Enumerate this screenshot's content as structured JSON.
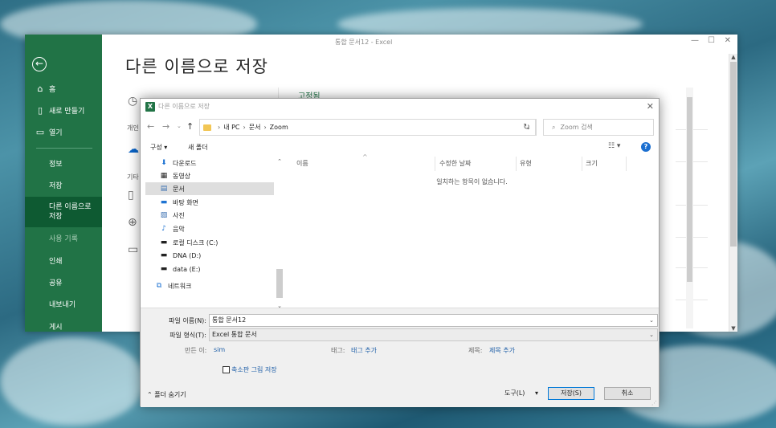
{
  "excel": {
    "window_title": "통합 문서12  -  Excel",
    "page_title": "다른 이름으로 저장",
    "recent_heading": "고정됨",
    "ghost_labels": {
      "personal": "개인",
      "other": "기타"
    },
    "sidebar": {
      "home": "홈",
      "new": "새로 만들기",
      "open": "열기",
      "info": "정보",
      "save": "저장",
      "save_as": "다른 이름으로\n저장",
      "history": "사용 기록",
      "print": "인쇄",
      "share": "공유",
      "export": "내보내기",
      "publish": "게시"
    }
  },
  "dialog": {
    "title": "다른 이름으로 저장",
    "address": {
      "items": [
        "내 PC",
        "문서",
        "Zoom"
      ]
    },
    "search_placeholder": "Zoom 검색",
    "toolbar": {
      "organize": "구성 ▾",
      "new_folder": "새 폴더"
    },
    "tree": [
      {
        "label": "다운로드",
        "icon": "download-icon"
      },
      {
        "label": "동영상",
        "icon": "video-icon"
      },
      {
        "label": "문서",
        "icon": "document-icon",
        "selected": true
      },
      {
        "label": "바탕 화면",
        "icon": "desktop-icon"
      },
      {
        "label": "사진",
        "icon": "picture-icon"
      },
      {
        "label": "음악",
        "icon": "music-icon"
      },
      {
        "label": "로컬 디스크 (C:)",
        "icon": "drive-icon"
      },
      {
        "label": "DNA (D:)",
        "icon": "drive-icon"
      },
      {
        "label": "data (E:)",
        "icon": "drive-icon"
      },
      {
        "label": "네트워크",
        "icon": "network-icon"
      }
    ],
    "columns": [
      "이름",
      "수정한 날짜",
      "유형",
      "크기"
    ],
    "empty_message": "일치하는 항목이 없습니다.",
    "file_name_label": "파일 이름(N):",
    "file_name_value": "통합 문서12",
    "file_type_label": "파일 형식(T):",
    "file_type_value": "Excel 통합 문서",
    "authors_label": "만든 이:",
    "authors_value": "sim",
    "tags_label": "태그:",
    "tags_value": "태그 추가",
    "title_label": "제목:",
    "title_value": "제목 추가",
    "thumbnail_label": "축소판 그림 저장",
    "hide_folders": "폴더 숨기기",
    "tools_label": "도구(L)",
    "save_button": "저장(S)",
    "cancel_button": "취소"
  }
}
